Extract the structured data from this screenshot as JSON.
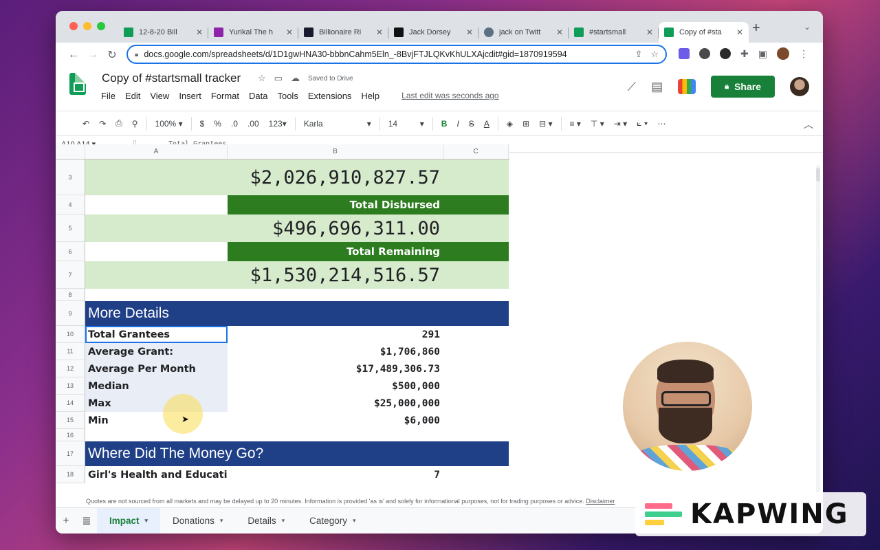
{
  "browser": {
    "tabs": [
      {
        "title": "12-8-20 Bill",
        "favicon_color": "#0f9d58"
      },
      {
        "title": "Yurikal The h",
        "favicon_color": "#8e24aa"
      },
      {
        "title": "Billionaire Ri",
        "favicon_color": "#1a1a2e"
      },
      {
        "title": "Jack Dorsey",
        "favicon_color": "#111111"
      },
      {
        "title": "jack on Twitt",
        "favicon_color": "#5b7083"
      },
      {
        "title": "#startsmall",
        "favicon_color": "#0f9d58"
      },
      {
        "title": "Copy of #sta",
        "favicon_color": "#0f9d58"
      }
    ],
    "url": "docs.google.com/spreadsheets/d/1D1gwHNA30-bbbnCahm5Eln_-8BvjFTJLQKvKhULXAjcdit#gid=1870919594"
  },
  "sheets": {
    "doc_title": "Copy of #startsmall tracker",
    "saved_status": "Saved to Drive",
    "menu": [
      "File",
      "Edit",
      "View",
      "Insert",
      "Format",
      "Data",
      "Tools",
      "Extensions",
      "Help"
    ],
    "last_edit": "Last edit was seconds ago",
    "share_label": "Share",
    "toolbar": {
      "zoom": "100%",
      "currency": "$",
      "percent": "%",
      "dec_decrease": ".0",
      "dec_increase": ".00",
      "more_formats": "123",
      "font": "Karla",
      "font_size": "14",
      "bold": "B",
      "italic": "I",
      "strike": "S",
      "text_color": "A"
    },
    "name_box": "A10 A14",
    "formula": "Total Grantees",
    "columns": [
      "A",
      "B",
      "C"
    ],
    "rows": {
      "r3": {
        "num": "3",
        "value": "$2,026,910,827.57"
      },
      "r4": {
        "num": "4",
        "label": "Total Disbursed"
      },
      "r5": {
        "num": "5",
        "value": "$496,696,311.00"
      },
      "r6": {
        "num": "6",
        "label": "Total Remaining"
      },
      "r7": {
        "num": "7",
        "value": "$1,530,214,516.57"
      },
      "r8": {
        "num": "8"
      },
      "r9": {
        "num": "9",
        "header": "More Details"
      },
      "r10": {
        "num": "10",
        "label": "Total Grantees",
        "value": "291"
      },
      "r11": {
        "num": "11",
        "label": "Average Grant:",
        "value": "$1,706,860"
      },
      "r12": {
        "num": "12",
        "label": "Average Per Month",
        "value": "$17,489,306.73"
      },
      "r13": {
        "num": "13",
        "label": "Median",
        "value": "$500,000"
      },
      "r14": {
        "num": "14",
        "label": "Max",
        "value": "$25,000,000"
      },
      "r15": {
        "num": "15",
        "label": "Min",
        "value": "$6,000"
      },
      "r16": {
        "num": "16"
      },
      "r17": {
        "num": "17",
        "header": "Where Did The Money Go?"
      },
      "r18": {
        "num": "18",
        "label": "Girl's Health and Educati",
        "value": "7"
      }
    },
    "disclaimer": "Quotes are not sourced from all markets and may be delayed up to 20 minutes. Information is provided 'as is' and solely for informational purposes, not for trading purposes or advice.",
    "disclaimer_link": "Disclaimer",
    "sheet_tabs": [
      "Impact",
      "Donations",
      "Details",
      "Category"
    ],
    "active_sheet": "Impact"
  },
  "colors": {
    "accent_green": "#2d7d20",
    "light_green": "#d5ebcb",
    "section_blue": "#1f3f87",
    "share_green": "#188038"
  },
  "watermark": {
    "text": "KAPWING"
  }
}
